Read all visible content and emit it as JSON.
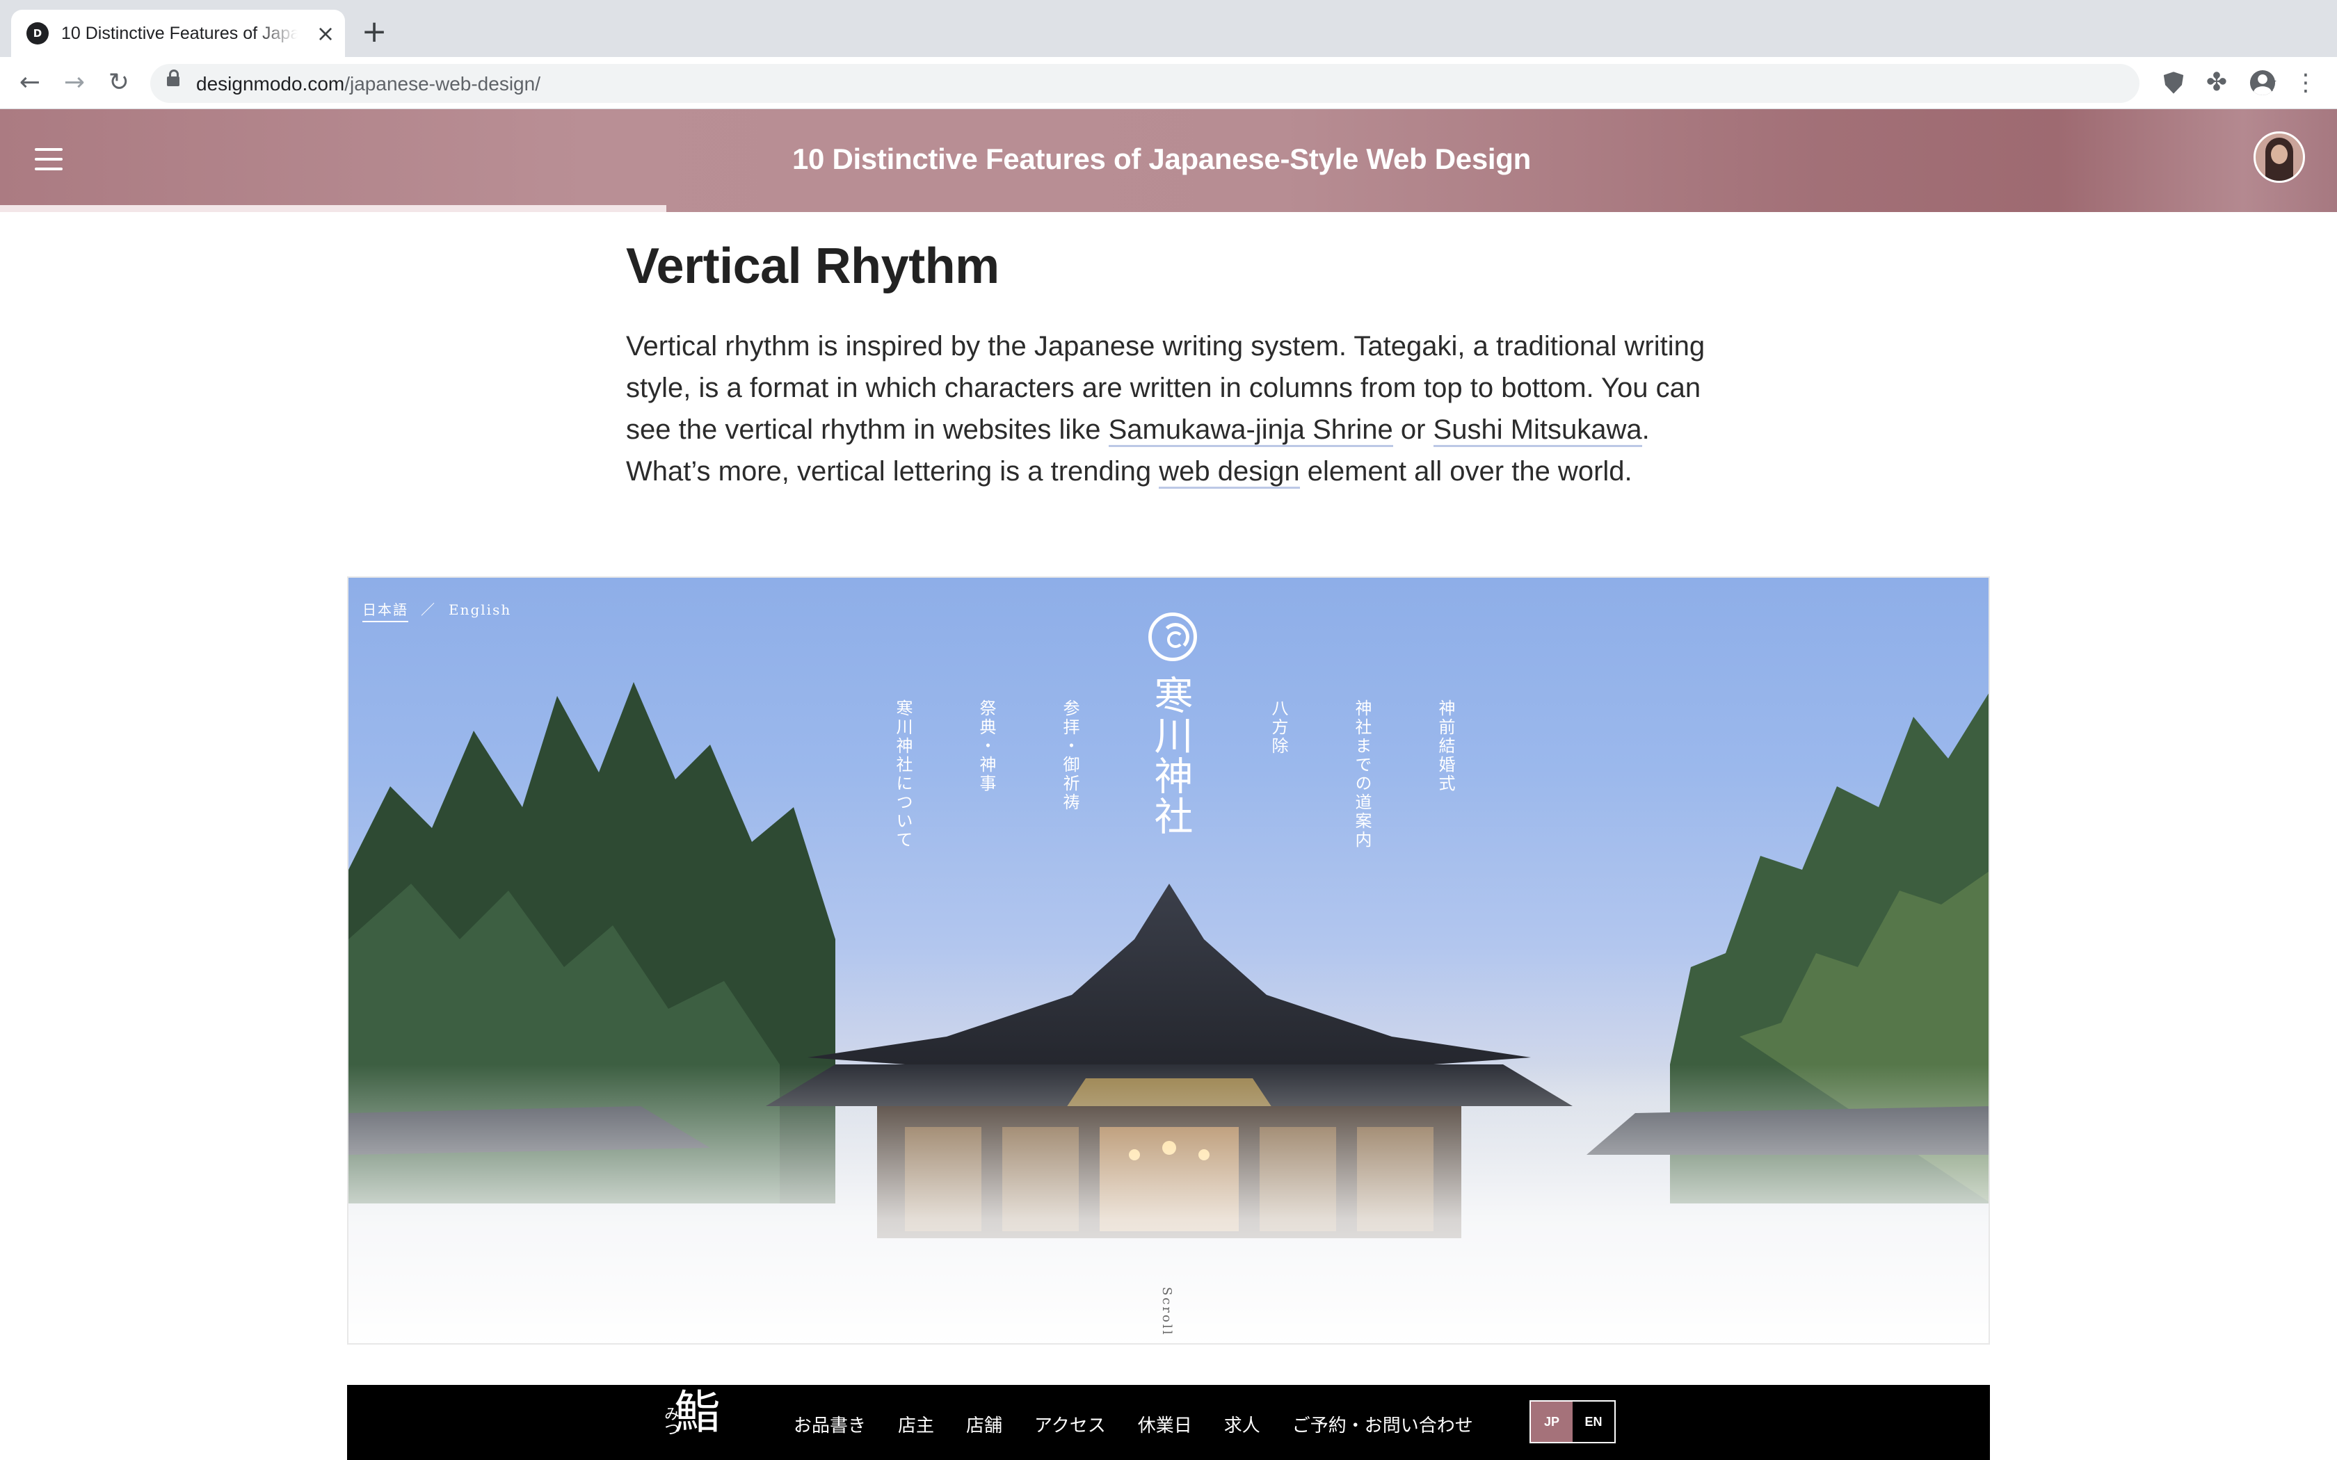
{
  "browser": {
    "tab_title": "10 Distinctive Features of Japanese-Style Web Design",
    "tab_favicon": "designmodo-logo-icon",
    "url_host": "designmodo.com",
    "url_path": "/japanese-web-design/",
    "icons": [
      "back-icon",
      "forward-icon",
      "reload-icon",
      "lock-icon",
      "star-icon",
      "shield-extension-icon",
      "puzzle-icon",
      "profile-icon",
      "more-icon",
      "close-icon",
      "plus-icon"
    ]
  },
  "site_header": {
    "title": "10 Distinctive Features of Japanese-Style Web Design",
    "reading_progress": 0.285,
    "brand_color": "#b58a90"
  },
  "article": {
    "heading": "Vertical Rhythm",
    "paragraph": {
      "text_1": "Vertical rhythm is inspired by the Japanese writing system. Tategaki, a traditional writing style, is a format in which characters are written in columns from top to bottom. You can see the vertical rhythm in websites like ",
      "link_1": "Samukawa-jinja Shrine",
      "text_2": " or ",
      "link_2": "Sushi Mitsukawa",
      "text_3": ". What’s more, vertical lettering is a trending ",
      "link_3": "web design",
      "text_4": " element all over the world."
    }
  },
  "example_shrine": {
    "lang_jp": "日本語",
    "lang_separator": "／",
    "lang_en": "English",
    "shrine_name": "寒川神社",
    "menu": [
      "神前結婚式",
      "神社までの道案内",
      "八方除",
      "参拝・御祈祷",
      "祭典・神事",
      "寒川神社について"
    ],
    "scroll": "Scroll"
  },
  "example_sushi": {
    "logo": "鮨",
    "logo_sub": "みつ",
    "nav": [
      "お品書き",
      "店主",
      "店舗",
      "アクセス",
      "休業日",
      "求人",
      "ご予約・お問い合わせ"
    ],
    "lang_jp": "JP",
    "lang_en": "EN"
  }
}
